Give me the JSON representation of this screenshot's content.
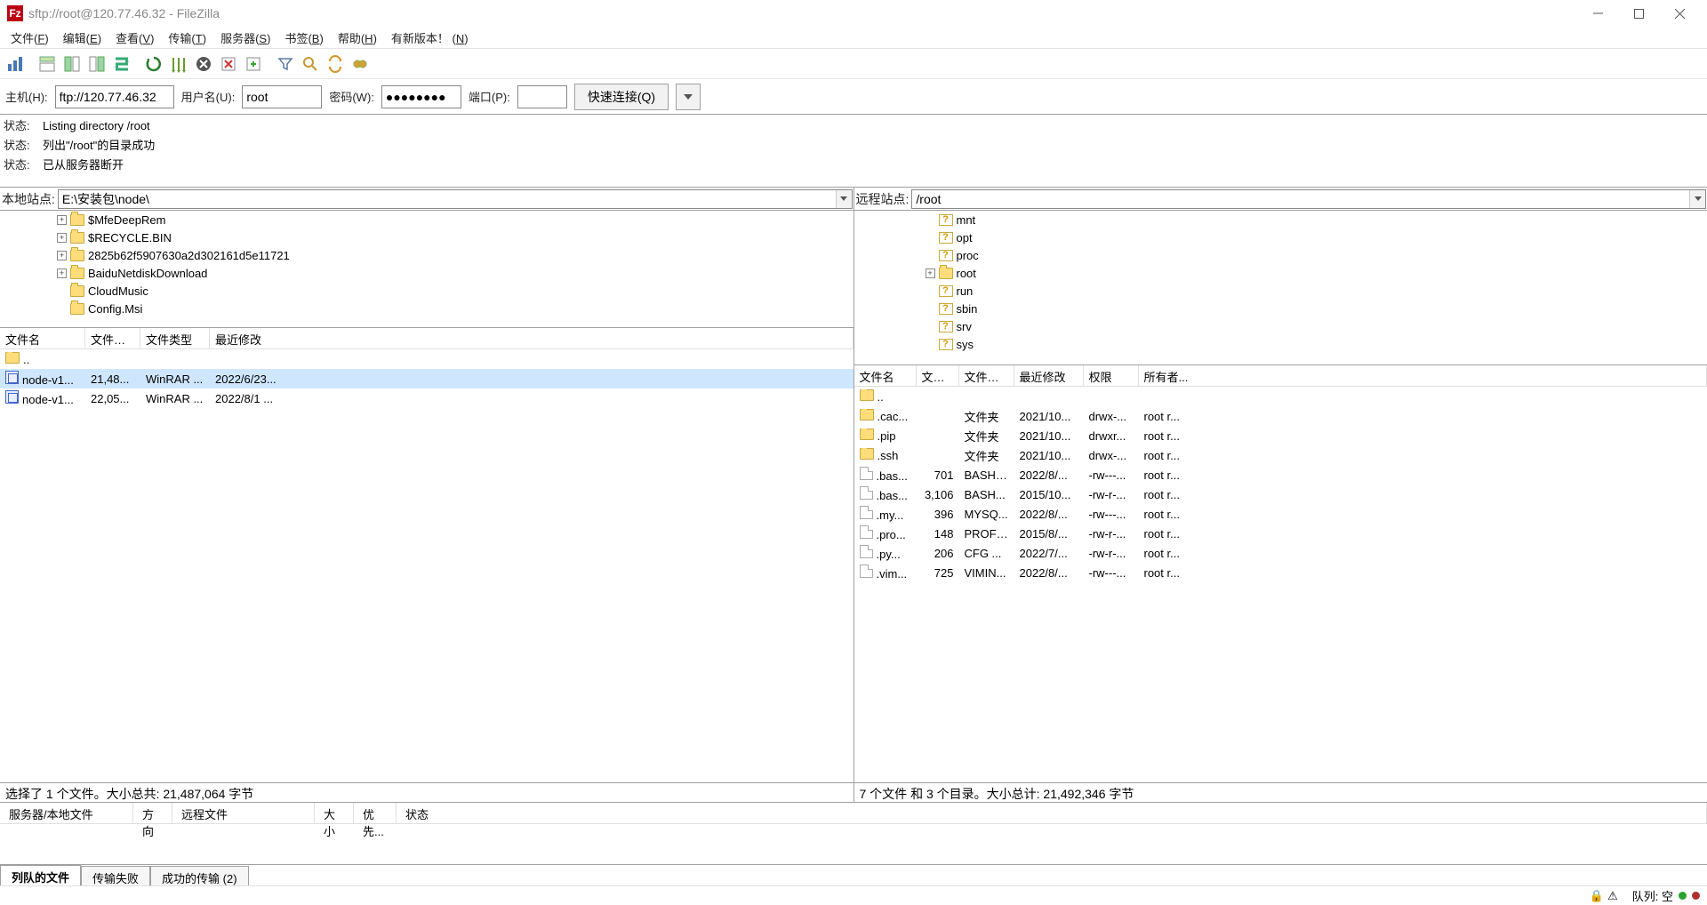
{
  "window": {
    "title": "sftp://root@120.77.46.32 - FileZilla",
    "logo": "Fz"
  },
  "menu": {
    "file": {
      "label": "文件",
      "accel": "F"
    },
    "edit": {
      "label": "编辑",
      "accel": "E"
    },
    "view": {
      "label": "查看",
      "accel": "V"
    },
    "transfer": {
      "label": "传输",
      "accel": "T"
    },
    "server": {
      "label": "服务器",
      "accel": "S"
    },
    "bookmark": {
      "label": "书签",
      "accel": "B"
    },
    "help": {
      "label": "帮助",
      "accel": "H"
    },
    "newver": {
      "label": "有新版本！",
      "accel": "N"
    }
  },
  "toolbar_icons": [
    "site-manager",
    "sep",
    "toggle-log",
    "toggle-localtree",
    "toggle-remotetree",
    "toggle-queue",
    "sep",
    "refresh",
    "process-queue",
    "cancel",
    "disconnect",
    "reconnect",
    "sep",
    "filter",
    "compare",
    "sync-browsing",
    "search"
  ],
  "conn": {
    "host_label": "主机(H):",
    "host_value": "ftp://120.77.46.32",
    "user_label": "用户名(U):",
    "user_value": "root",
    "pass_label": "密码(W):",
    "pass_value": "●●●●●●●●",
    "port_label": "端口(P):",
    "port_value": "",
    "quick_label": "快速连接(Q)"
  },
  "log": [
    {
      "label": "状态:",
      "text": "Listing directory /root"
    },
    {
      "label": "状态:",
      "text": "列出\"/root\"的目录成功"
    },
    {
      "label": "状态:",
      "text": "已从服务器断开"
    }
  ],
  "local": {
    "site_label": "本地站点:",
    "site_path": "E:\\安装包\\node\\",
    "tree": [
      {
        "indent": 64,
        "expand": "+",
        "kind": "folder",
        "name": "$MfeDeepRem"
      },
      {
        "indent": 64,
        "expand": "+",
        "kind": "folder",
        "name": "$RECYCLE.BIN"
      },
      {
        "indent": 64,
        "expand": "+",
        "kind": "folder",
        "name": "2825b62f5907630a2d302161d5e11721"
      },
      {
        "indent": 64,
        "expand": "+",
        "kind": "folder",
        "name": "BaiduNetdiskDownload"
      },
      {
        "indent": 64,
        "expand": "",
        "kind": "folder",
        "name": "CloudMusic"
      },
      {
        "indent": 64,
        "expand": "",
        "kind": "folder",
        "name": "Config.Msi"
      }
    ],
    "headers": {
      "name": "文件名",
      "size": "文件大...",
      "type": "文件类型",
      "mod": "最近修改"
    },
    "rows": [
      {
        "icon": "folder",
        "name": "..",
        "size": "",
        "type": "",
        "mod": ""
      },
      {
        "icon": "archive",
        "name": "node-v1...",
        "size": "21,48...",
        "type": "WinRAR ...",
        "mod": "2022/6/23...",
        "selected": true
      },
      {
        "icon": "archive",
        "name": "node-v1...",
        "size": "22,05...",
        "type": "WinRAR ...",
        "mod": "2022/8/1 ..."
      }
    ],
    "status": "选择了 1 个文件。大小总共: 21,487,064 字节"
  },
  "remote": {
    "site_label": "远程站点:",
    "site_path": "/root",
    "tree": [
      {
        "indent": 80,
        "expand": "",
        "kind": "unknown",
        "name": "mnt"
      },
      {
        "indent": 80,
        "expand": "",
        "kind": "unknown",
        "name": "opt"
      },
      {
        "indent": 80,
        "expand": "",
        "kind": "unknown",
        "name": "proc"
      },
      {
        "indent": 80,
        "expand": "+",
        "kind": "folder",
        "name": "root"
      },
      {
        "indent": 80,
        "expand": "",
        "kind": "unknown",
        "name": "run"
      },
      {
        "indent": 80,
        "expand": "",
        "kind": "unknown",
        "name": "sbin"
      },
      {
        "indent": 80,
        "expand": "",
        "kind": "unknown",
        "name": "srv"
      },
      {
        "indent": 80,
        "expand": "",
        "kind": "unknown",
        "name": "sys"
      }
    ],
    "headers": {
      "name": "文件名",
      "size": "文件...",
      "type": "文件类...",
      "mod": "最近修改",
      "perm": "权限",
      "own": "所有者..."
    },
    "rows": [
      {
        "icon": "folder",
        "name": "..",
        "size": "",
        "type": "",
        "mod": "",
        "perm": "",
        "own": ""
      },
      {
        "icon": "folder",
        "name": ".cac...",
        "size": "",
        "type": "文件夹",
        "mod": "2021/10...",
        "perm": "drwx-...",
        "own": "root r..."
      },
      {
        "icon": "folder",
        "name": ".pip",
        "size": "",
        "type": "文件夹",
        "mod": "2021/10...",
        "perm": "drwxr...",
        "own": "root r..."
      },
      {
        "icon": "folder",
        "name": ".ssh",
        "size": "",
        "type": "文件夹",
        "mod": "2021/10...",
        "perm": "drwx-...",
        "own": "root r..."
      },
      {
        "icon": "file",
        "name": ".bas...",
        "size": "701",
        "type": "BASH_...",
        "mod": "2022/8/...",
        "perm": "-rw---...",
        "own": "root r..."
      },
      {
        "icon": "file",
        "name": ".bas...",
        "size": "3,106",
        "type": "BASH...",
        "mod": "2015/10...",
        "perm": "-rw-r-...",
        "own": "root r..."
      },
      {
        "icon": "file",
        "name": ".my...",
        "size": "396",
        "type": "MYSQ...",
        "mod": "2022/8/...",
        "perm": "-rw---...",
        "own": "root r..."
      },
      {
        "icon": "file",
        "name": ".pro...",
        "size": "148",
        "type": "PROFI...",
        "mod": "2015/8/...",
        "perm": "-rw-r-...",
        "own": "root r..."
      },
      {
        "icon": "file",
        "name": ".py...",
        "size": "206",
        "type": "CFG ...",
        "mod": "2022/7/...",
        "perm": "-rw-r-...",
        "own": "root r..."
      },
      {
        "icon": "file",
        "name": ".vim...",
        "size": "725",
        "type": "VIMIN...",
        "mod": "2022/8/...",
        "perm": "-rw---...",
        "own": "root r..."
      }
    ],
    "status": "7 个文件 和 3 个目录。大小总计: 21,492,346 字节"
  },
  "queue": {
    "headers": {
      "file": "服务器/本地文件",
      "dir": "方向",
      "rf": "远程文件",
      "size": "大小",
      "pri": "优先...",
      "stat": "状态"
    }
  },
  "tabs": {
    "queued": "列队的文件",
    "failed": "传输失败",
    "success": "成功的传输 (2)"
  },
  "statusbar": {
    "queue_label": "队列: 空"
  },
  "colors": {
    "accent": "#bd0013",
    "green": "#29a32e",
    "red": "#b03030"
  }
}
